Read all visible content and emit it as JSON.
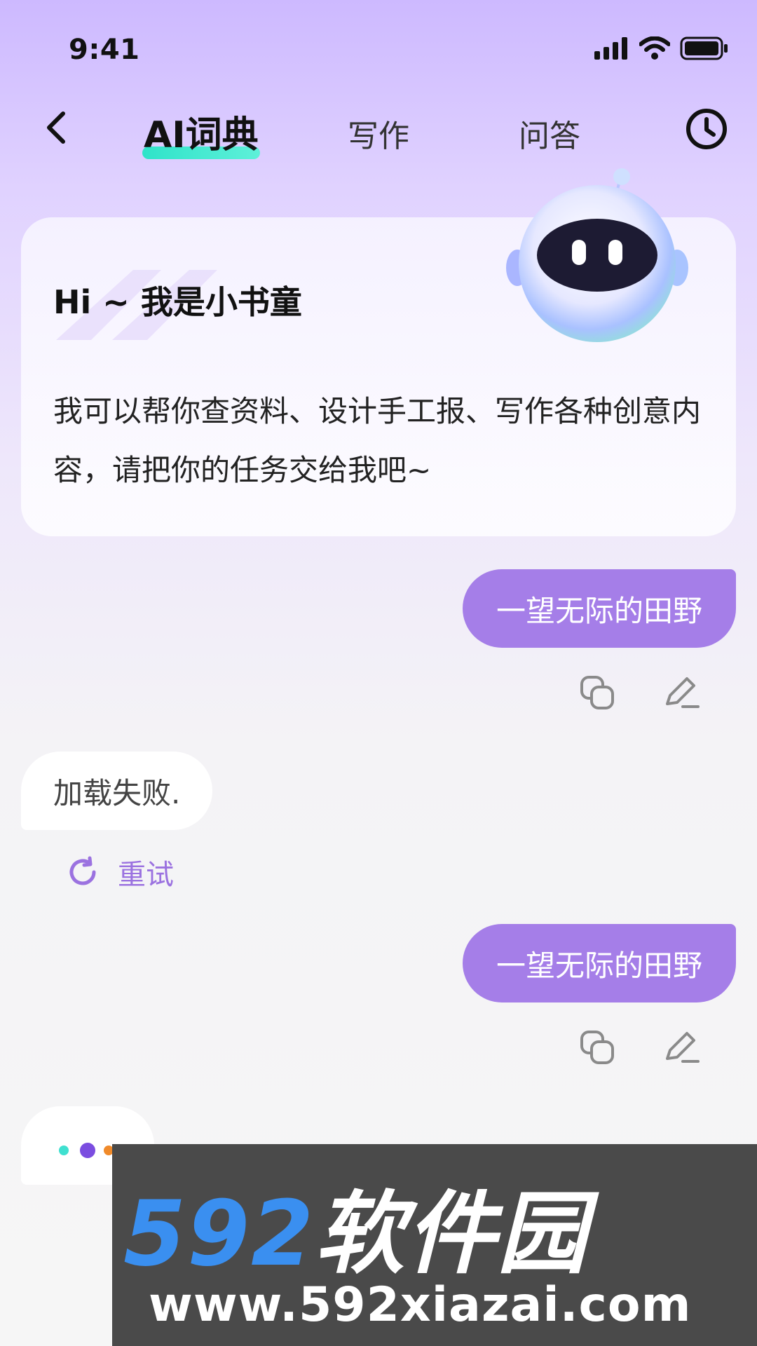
{
  "status": {
    "time": "9:41"
  },
  "nav": {
    "tabs": [
      {
        "label": "AI词典",
        "active": true
      },
      {
        "label": "写作",
        "active": false
      },
      {
        "label": "问答",
        "active": false
      }
    ]
  },
  "welcome": {
    "title": "Hi ~ 我是小书童",
    "text": "我可以帮你查资料、设计手工报、写作各种创意内容，请把你的任务交给我吧~"
  },
  "messages": [
    {
      "role": "user",
      "text": "一望无际的田野"
    },
    {
      "role": "bot",
      "text": "加载失败."
    },
    {
      "role": "user",
      "text": "一望无际的田野"
    }
  ],
  "retry": {
    "label": "重试"
  },
  "watermark": {
    "brand_number": "592",
    "brand_text": "软件园",
    "url": "www.592xiazai.com"
  },
  "colors": {
    "accent": "#a57ee8",
    "tab_underline": "#2fe3c9",
    "retry": "#9b72e0"
  },
  "icons": [
    "back-arrow-icon",
    "history-clock-icon",
    "copy-icon",
    "edit-pencil-icon",
    "retry-refresh-icon",
    "robot-mascot-icon",
    "signal-icon",
    "wifi-icon",
    "battery-icon"
  ]
}
